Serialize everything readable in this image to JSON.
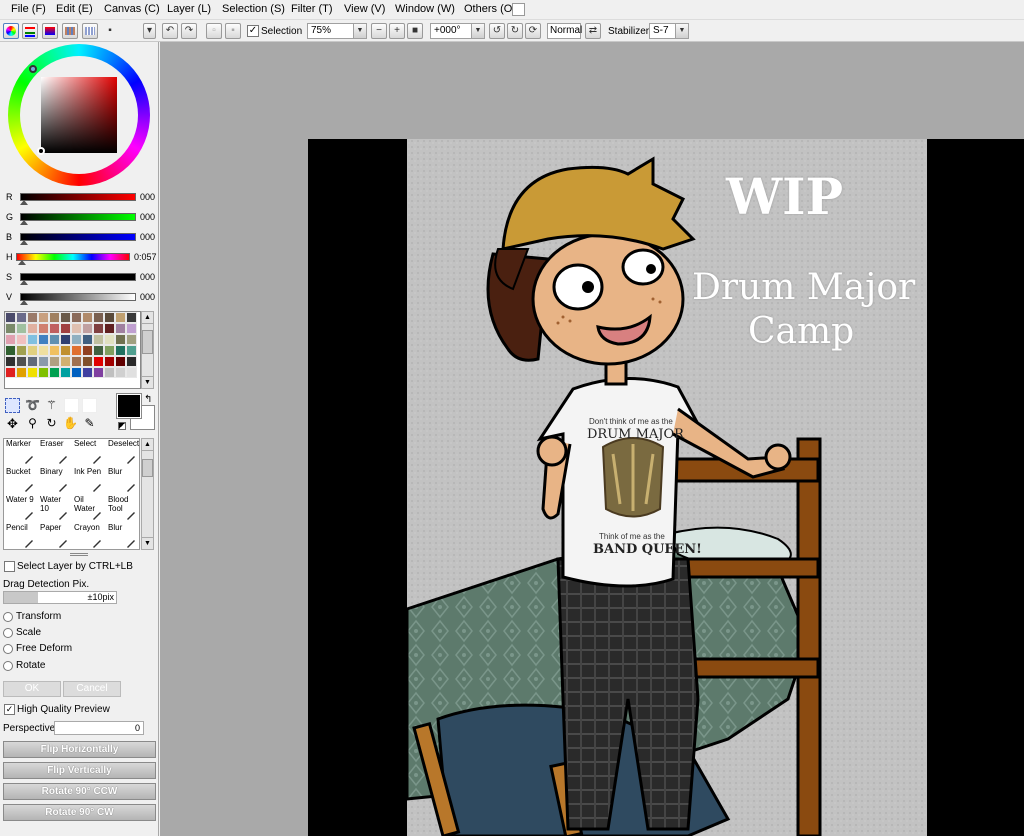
{
  "menubar": {
    "items": [
      "File (F)",
      "Edit (E)",
      "Canvas (C)",
      "Layer (L)",
      "Selection (S)",
      "Filter (T)",
      "View (V)",
      "Window (W)",
      "Others (O)"
    ]
  },
  "toolbar": {
    "selection_label": "Selection",
    "zoom_value": "75%",
    "rotation_value": "+000°",
    "blend_mode": "Normal",
    "stabilizer_label": "Stabilizer",
    "stabilizer_value": "S-7"
  },
  "color_sliders": [
    {
      "label": "R",
      "value": "000"
    },
    {
      "label": "G",
      "value": "000"
    },
    {
      "label": "B",
      "value": "000"
    },
    {
      "label": "H",
      "value": "0:057"
    },
    {
      "label": "S",
      "value": "000"
    },
    {
      "label": "V",
      "value": "000"
    }
  ],
  "palette_colors": [
    "#4a4a6a",
    "#6a6a8a",
    "#9a7a6a",
    "#c8a080",
    "#a08060",
    "#6a5a4a",
    "#8a6a5a",
    "#b08a6a",
    "#7a6050",
    "#5a4a3a",
    "#c0a070",
    "#3a3a3a",
    "#7a8a6a",
    "#a0c0a0",
    "#e0b0a0",
    "#d08070",
    "#c06060",
    "#a04040",
    "#e0c0b0",
    "#c0a0a0",
    "#804040",
    "#602020",
    "#a080a0",
    "#c0a0d0",
    "#e0a0b0",
    "#f0c0c0",
    "#80c0e0",
    "#4080c0",
    "#6090b0",
    "#304070",
    "#90b0c0",
    "#406080",
    "#c0c0a0",
    "#e0e0c0",
    "#707050",
    "#a0a080",
    "#306030",
    "#a0a050",
    "#e0d080",
    "#f0e0a0",
    "#f0c060",
    "#c09030",
    "#e07030",
    "#904020",
    "#406040",
    "#80a060",
    "#207060",
    "#50a090",
    "#303030",
    "#505050",
    "#606a7a",
    "#8a9aaa",
    "#b0a080",
    "#d0b070",
    "#a07050",
    "#80502a",
    "#e00000",
    "#a00000",
    "#600000",
    "#2a2a2a",
    "#e02020",
    "#e0a000",
    "#f0e000",
    "#80c000",
    "#00a050",
    "#00a0a0",
    "#0060c0",
    "#4040a0",
    "#8040a0",
    "#c0c0c0",
    "#d0d0d0",
    "#e0e0e0"
  ],
  "tools": [
    {
      "label": "Marker"
    },
    {
      "label": "Eraser"
    },
    {
      "label": "Select"
    },
    {
      "label": "Deselect"
    },
    {
      "label": "Bucket"
    },
    {
      "label": "Binary"
    },
    {
      "label": "Ink Pen"
    },
    {
      "label": "Blur"
    },
    {
      "label": "Water 9"
    },
    {
      "label": "Water 10"
    },
    {
      "label": "Oil Water"
    },
    {
      "label": "Blood Tool"
    },
    {
      "label": "Pencil"
    },
    {
      "label": "Paper"
    },
    {
      "label": "Crayon"
    },
    {
      "label": "Blur"
    }
  ],
  "options": {
    "select_layer_label": "Select Layer by CTRL+LB",
    "drag_detection_label": "Drag Detection Pix.",
    "drag_detection_value": "±10pix",
    "drag_detection_fill": 0.3,
    "transform_label": "Transform",
    "scale_label": "Scale",
    "free_deform_label": "Free Deform",
    "rotate_label": "Rotate",
    "ok_label": "OK",
    "cancel_label": "Cancel",
    "high_quality_label": "High Quality Preview",
    "perspective_label": "Perspective",
    "perspective_value": "0",
    "flip_h_label": "Flip Horizontally",
    "flip_v_label": "Flip Vertically",
    "rotate_ccw_label": "Rotate 90° CCW",
    "rotate_cw_label": "Rotate 90° CW"
  },
  "artwork": {
    "title_text": "WIP",
    "subtitle_line1": "Drum Major",
    "subtitle_line2": "Camp",
    "shirt_line1": "Don't think of me as the",
    "shirt_line2": "DRUM MAJOR",
    "shirt_line3": "Think of me as the",
    "shirt_line4": "BAND QUEEN!"
  }
}
